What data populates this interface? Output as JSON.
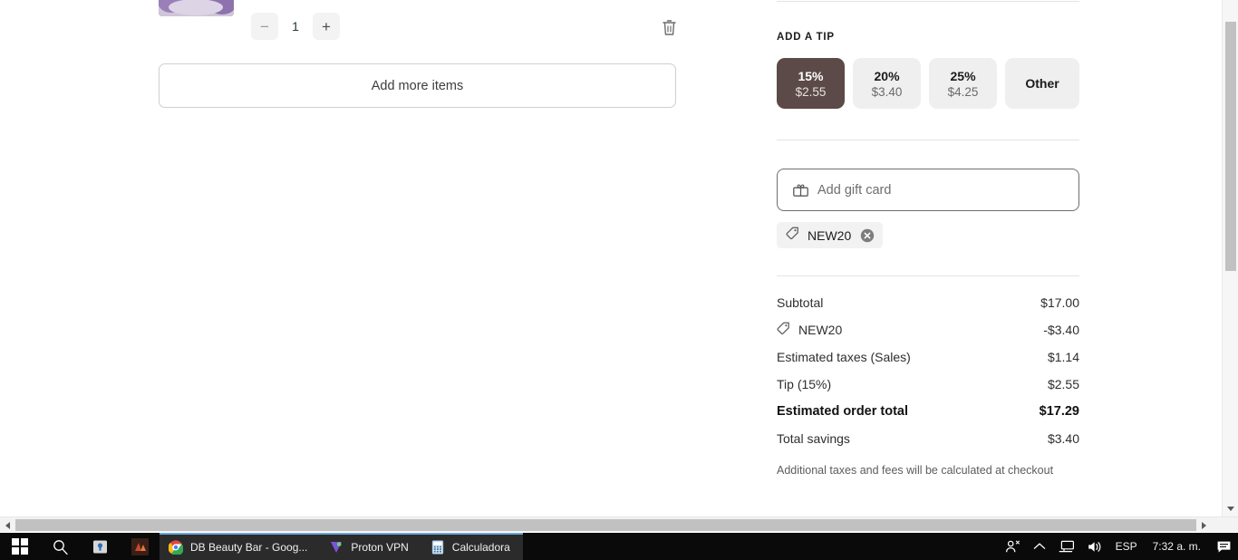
{
  "cart": {
    "quantity": "1",
    "decrease_label": "−",
    "increase_label": "+",
    "delete_name": "trash-icon",
    "add_more_label": "Add more items"
  },
  "summary": {
    "tip_section_label": "ADD A TIP",
    "tip_options": [
      {
        "percent": "15%",
        "amount": "$2.55",
        "selected": true
      },
      {
        "percent": "20%",
        "amount": "$3.40",
        "selected": false
      },
      {
        "percent": "25%",
        "amount": "$4.25",
        "selected": false
      }
    ],
    "tip_other_label": "Other",
    "giftcard": {
      "placeholder": "Add gift card",
      "value": ""
    },
    "discount_chip": {
      "code": "NEW20",
      "remove_label": "✕"
    },
    "totals": [
      {
        "label": "Subtotal",
        "value": "$17.00",
        "icon": false,
        "strong": false
      },
      {
        "label": "NEW20",
        "value": "-$3.40",
        "icon": true,
        "strong": false
      },
      {
        "label": "Estimated taxes (Sales)",
        "value": "$1.14",
        "icon": false,
        "strong": false
      },
      {
        "label": "Tip (15%)",
        "value": "$2.55",
        "icon": false,
        "strong": false
      },
      {
        "label": "Estimated order total",
        "value": "$17.29",
        "icon": false,
        "strong": true
      },
      {
        "label": "Total savings",
        "value": "$3.40",
        "icon": false,
        "strong": false
      }
    ],
    "fine_print": "Additional taxes and fees will be calculated at checkout"
  },
  "taskbar": {
    "tasks": [
      {
        "label": "DB Beauty Bar - Goog...",
        "icon": "chrome-icon",
        "active": true
      },
      {
        "label": "Proton VPN",
        "icon": "proton-vpn-icon",
        "active": true
      },
      {
        "label": "Calculadora",
        "icon": "calculator-icon",
        "active": true
      }
    ],
    "tray": {
      "language": "ESP",
      "clock": "7:32 a. m."
    }
  },
  "colors": {
    "tip_selected": "#5b4a47",
    "tip_idle": "#efefef",
    "accent_taskbar": "#6aa7dd"
  }
}
